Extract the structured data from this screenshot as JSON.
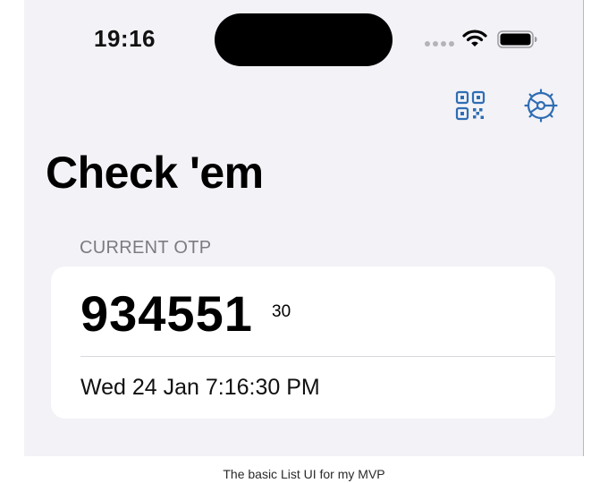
{
  "status_bar": {
    "time": "19:16",
    "icons": [
      "cellular-signal-icon",
      "wifi-icon",
      "battery-icon"
    ]
  },
  "toolbar": {
    "icons": [
      "qr-code-icon",
      "settings-gear-icon"
    ]
  },
  "title": "Check 'em",
  "section": {
    "header": "CURRENT OTP",
    "otp_code": "934551",
    "seconds_remaining": "30",
    "timestamp": "Wed 24 Jan 7:16:30 PM"
  },
  "caption": "The basic List UI for my MVP",
  "colors": {
    "accent": "#2f6db3",
    "background": "#f2f2f7",
    "card": "#ffffff",
    "secondary_text": "#7c7c80"
  }
}
